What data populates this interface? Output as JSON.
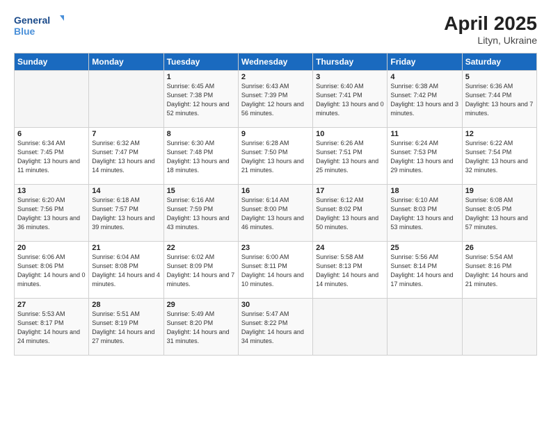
{
  "header": {
    "logo_line1": "General",
    "logo_line2": "Blue",
    "title": "April 2025",
    "subtitle": "Lityn, Ukraine"
  },
  "weekdays": [
    "Sunday",
    "Monday",
    "Tuesday",
    "Wednesday",
    "Thursday",
    "Friday",
    "Saturday"
  ],
  "weeks": [
    [
      {
        "day": "",
        "info": ""
      },
      {
        "day": "",
        "info": ""
      },
      {
        "day": "1",
        "info": "Sunrise: 6:45 AM\nSunset: 7:38 PM\nDaylight: 12 hours and 52 minutes."
      },
      {
        "day": "2",
        "info": "Sunrise: 6:43 AM\nSunset: 7:39 PM\nDaylight: 12 hours and 56 minutes."
      },
      {
        "day": "3",
        "info": "Sunrise: 6:40 AM\nSunset: 7:41 PM\nDaylight: 13 hours and 0 minutes."
      },
      {
        "day": "4",
        "info": "Sunrise: 6:38 AM\nSunset: 7:42 PM\nDaylight: 13 hours and 3 minutes."
      },
      {
        "day": "5",
        "info": "Sunrise: 6:36 AM\nSunset: 7:44 PM\nDaylight: 13 hours and 7 minutes."
      }
    ],
    [
      {
        "day": "6",
        "info": "Sunrise: 6:34 AM\nSunset: 7:45 PM\nDaylight: 13 hours and 11 minutes."
      },
      {
        "day": "7",
        "info": "Sunrise: 6:32 AM\nSunset: 7:47 PM\nDaylight: 13 hours and 14 minutes."
      },
      {
        "day": "8",
        "info": "Sunrise: 6:30 AM\nSunset: 7:48 PM\nDaylight: 13 hours and 18 minutes."
      },
      {
        "day": "9",
        "info": "Sunrise: 6:28 AM\nSunset: 7:50 PM\nDaylight: 13 hours and 21 minutes."
      },
      {
        "day": "10",
        "info": "Sunrise: 6:26 AM\nSunset: 7:51 PM\nDaylight: 13 hours and 25 minutes."
      },
      {
        "day": "11",
        "info": "Sunrise: 6:24 AM\nSunset: 7:53 PM\nDaylight: 13 hours and 29 minutes."
      },
      {
        "day": "12",
        "info": "Sunrise: 6:22 AM\nSunset: 7:54 PM\nDaylight: 13 hours and 32 minutes."
      }
    ],
    [
      {
        "day": "13",
        "info": "Sunrise: 6:20 AM\nSunset: 7:56 PM\nDaylight: 13 hours and 36 minutes."
      },
      {
        "day": "14",
        "info": "Sunrise: 6:18 AM\nSunset: 7:57 PM\nDaylight: 13 hours and 39 minutes."
      },
      {
        "day": "15",
        "info": "Sunrise: 6:16 AM\nSunset: 7:59 PM\nDaylight: 13 hours and 43 minutes."
      },
      {
        "day": "16",
        "info": "Sunrise: 6:14 AM\nSunset: 8:00 PM\nDaylight: 13 hours and 46 minutes."
      },
      {
        "day": "17",
        "info": "Sunrise: 6:12 AM\nSunset: 8:02 PM\nDaylight: 13 hours and 50 minutes."
      },
      {
        "day": "18",
        "info": "Sunrise: 6:10 AM\nSunset: 8:03 PM\nDaylight: 13 hours and 53 minutes."
      },
      {
        "day": "19",
        "info": "Sunrise: 6:08 AM\nSunset: 8:05 PM\nDaylight: 13 hours and 57 minutes."
      }
    ],
    [
      {
        "day": "20",
        "info": "Sunrise: 6:06 AM\nSunset: 8:06 PM\nDaylight: 14 hours and 0 minutes."
      },
      {
        "day": "21",
        "info": "Sunrise: 6:04 AM\nSunset: 8:08 PM\nDaylight: 14 hours and 4 minutes."
      },
      {
        "day": "22",
        "info": "Sunrise: 6:02 AM\nSunset: 8:09 PM\nDaylight: 14 hours and 7 minutes."
      },
      {
        "day": "23",
        "info": "Sunrise: 6:00 AM\nSunset: 8:11 PM\nDaylight: 14 hours and 10 minutes."
      },
      {
        "day": "24",
        "info": "Sunrise: 5:58 AM\nSunset: 8:13 PM\nDaylight: 14 hours and 14 minutes."
      },
      {
        "day": "25",
        "info": "Sunrise: 5:56 AM\nSunset: 8:14 PM\nDaylight: 14 hours and 17 minutes."
      },
      {
        "day": "26",
        "info": "Sunrise: 5:54 AM\nSunset: 8:16 PM\nDaylight: 14 hours and 21 minutes."
      }
    ],
    [
      {
        "day": "27",
        "info": "Sunrise: 5:53 AM\nSunset: 8:17 PM\nDaylight: 14 hours and 24 minutes."
      },
      {
        "day": "28",
        "info": "Sunrise: 5:51 AM\nSunset: 8:19 PM\nDaylight: 14 hours and 27 minutes."
      },
      {
        "day": "29",
        "info": "Sunrise: 5:49 AM\nSunset: 8:20 PM\nDaylight: 14 hours and 31 minutes."
      },
      {
        "day": "30",
        "info": "Sunrise: 5:47 AM\nSunset: 8:22 PM\nDaylight: 14 hours and 34 minutes."
      },
      {
        "day": "",
        "info": ""
      },
      {
        "day": "",
        "info": ""
      },
      {
        "day": "",
        "info": ""
      }
    ]
  ]
}
